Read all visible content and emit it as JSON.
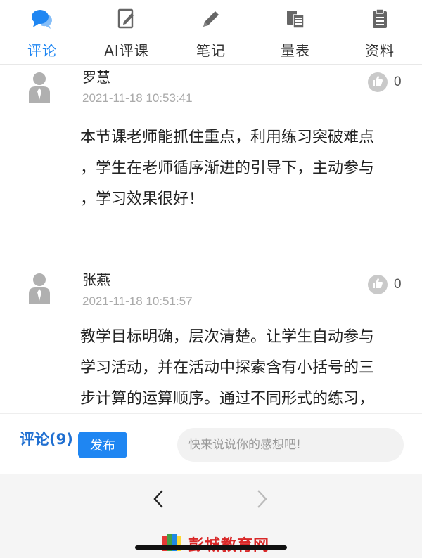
{
  "tabs": [
    {
      "label": "评论",
      "icon": "chat-bubbles-icon",
      "active": true
    },
    {
      "label": "AI评课",
      "icon": "edit-document-icon",
      "active": false
    },
    {
      "label": "笔记",
      "icon": "pencil-icon",
      "active": false
    },
    {
      "label": "量表",
      "icon": "document-list-icon",
      "active": false
    },
    {
      "label": "资料",
      "icon": "clipboard-icon",
      "active": false
    }
  ],
  "comments": [
    {
      "author": "罗慧",
      "time": "2021-11-18 10:53:41",
      "likes": "0",
      "lines": [
        "本节课老师能抓住重点，利用练习突破难点",
        "，学生在老师循序渐进的引导下，主动参与",
        "，学习效果很好！"
      ]
    },
    {
      "author": "张燕",
      "time": "2021-11-18 10:51:57",
      "likes": "0",
      "lines": [
        "教学目标明确，层次清楚。让学生自动参与",
        "学习活动，并在活动中探索含有小括号的三",
        "步计算的运算顺序。通过不同形式的练习，"
      ]
    }
  ],
  "comment_bar": {
    "count_label": "评论(9)",
    "publish_label": "发布",
    "input_placeholder": "快来说说你的感想吧!"
  },
  "watermark": {
    "text": "彭城教育网"
  },
  "colors": {
    "accent": "#1f86f2",
    "watermark": "#d92828"
  }
}
